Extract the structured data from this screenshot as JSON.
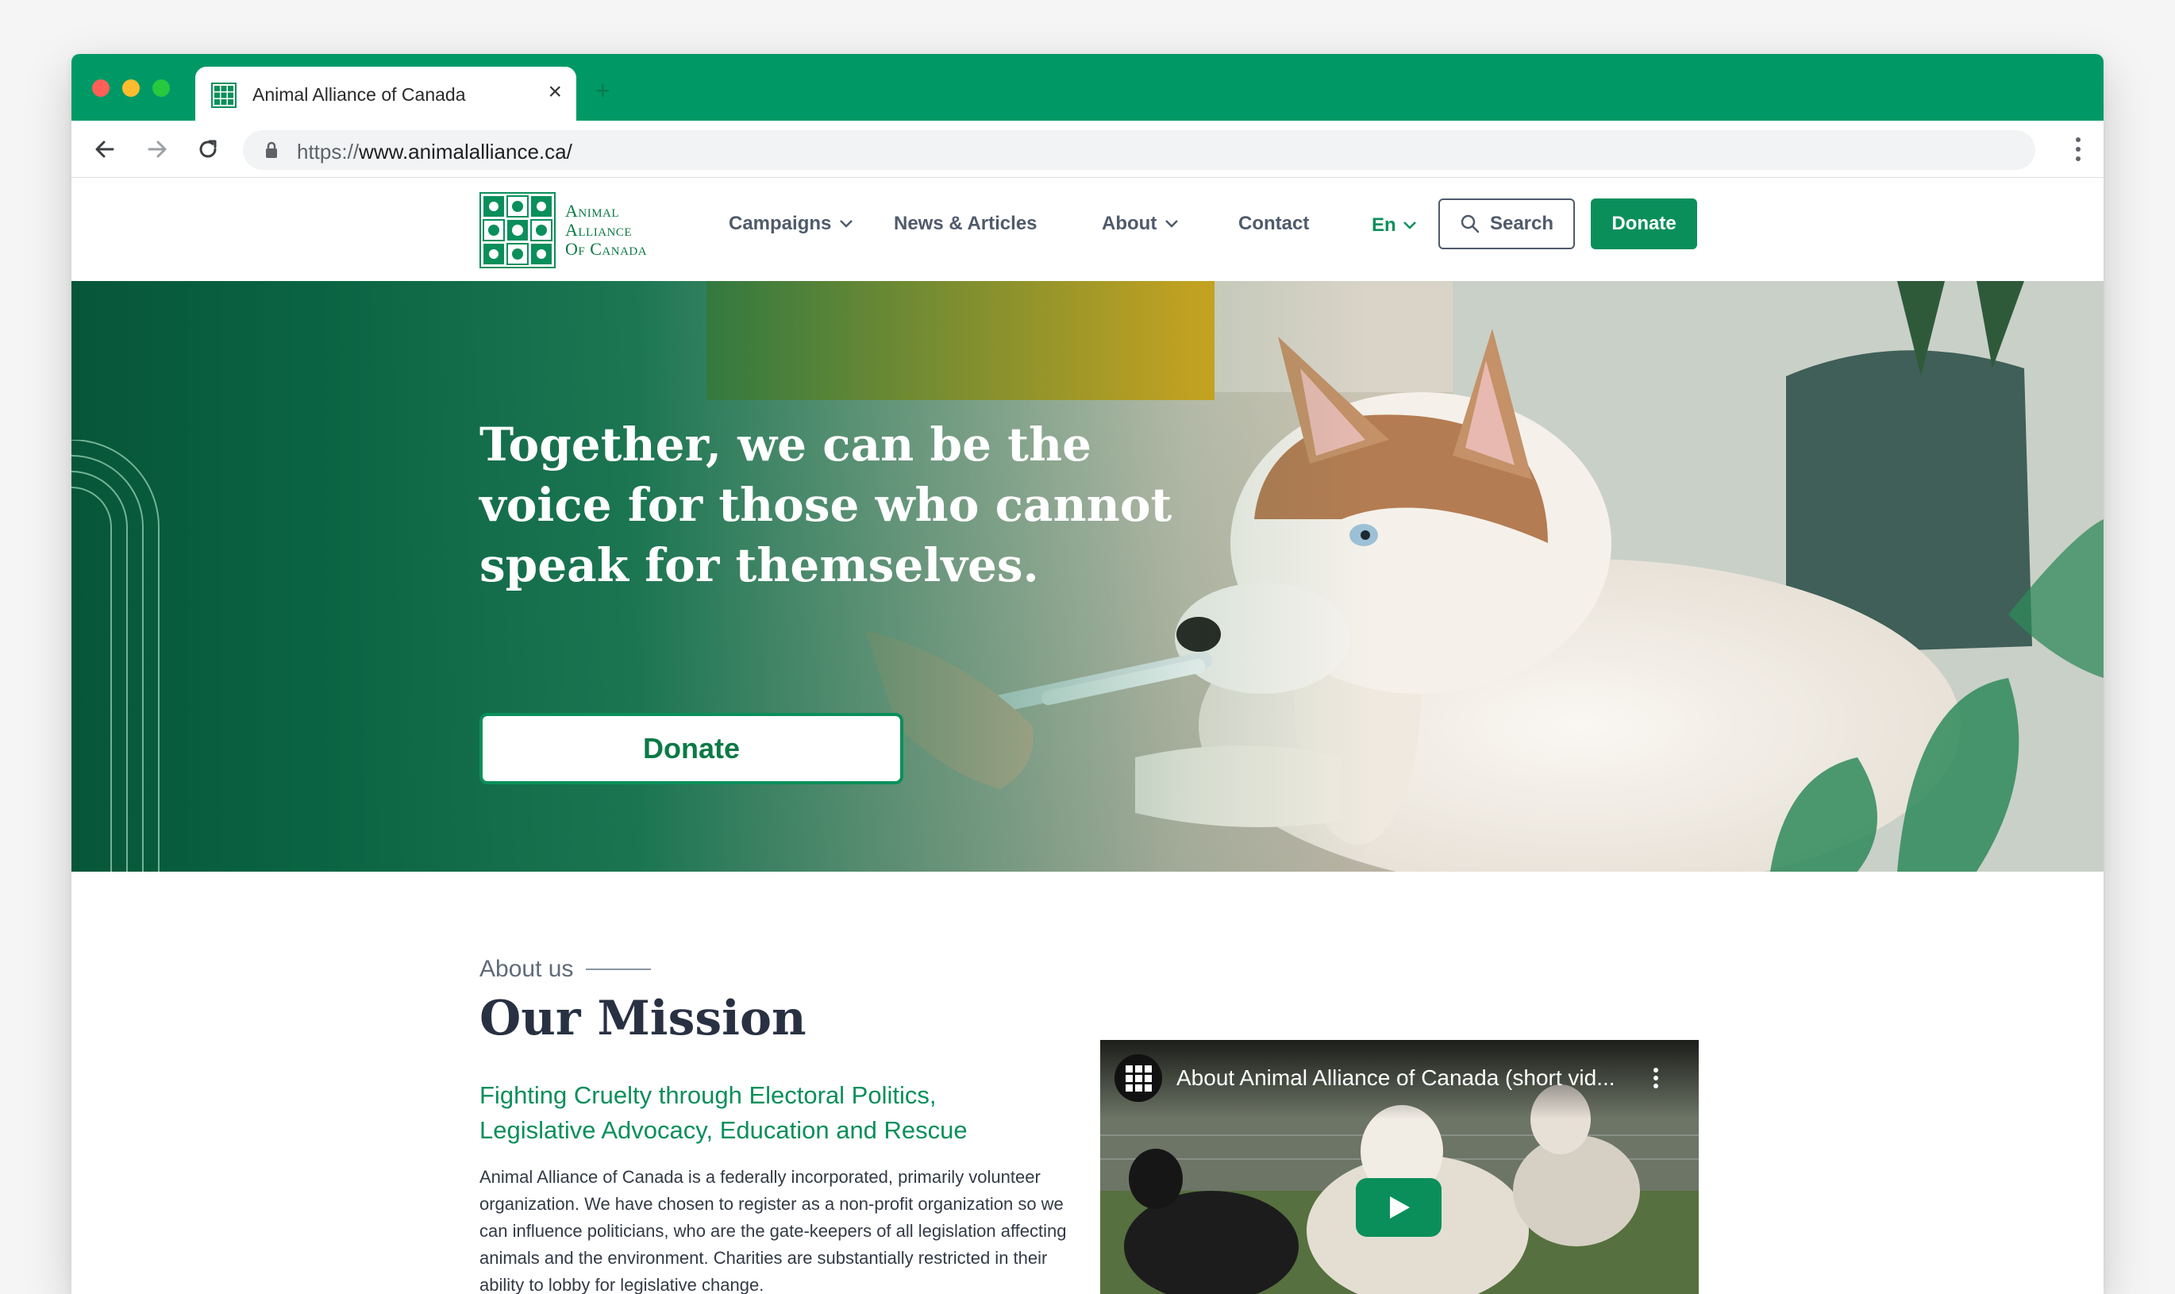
{
  "browser": {
    "tab_title": "Animal Alliance of Canada",
    "tab_close": "×",
    "new_tab": "+",
    "url_scheme": "https://",
    "url_rest": "www.animalalliance.ca/"
  },
  "colors": {
    "brand_green": "#0a8f5b",
    "tabbar_green": "#009966",
    "heading_dark": "#283142"
  },
  "logo": {
    "line1": "Animal",
    "line2": "Alliance",
    "line3": "Of Canada"
  },
  "nav": {
    "campaigns": "Campaigns",
    "news": "News & Articles",
    "about": "About",
    "contact": "Contact",
    "lang": "En",
    "search": "Search",
    "donate": "Donate"
  },
  "hero": {
    "title": "Together, we can be the voice for those who cannot speak for themselves.",
    "donate": "Donate"
  },
  "mission": {
    "eyebrow": "About us",
    "title": "Our Mission",
    "subtitle": "Fighting Cruelty through Electoral Politics, Legislative Advocacy, Education and Rescue",
    "body": "Animal Alliance of Canada is a federally incorporated, primarily volunteer organization. We have chosen to register as a non-profit organization so we can influence politicians, who are the gate-keepers of all legislation affecting animals and the environment. Charities are substantially restricted in their ability to lobby for legislative change."
  },
  "video": {
    "title": "About Animal Alliance of Canada (short vid..."
  },
  "icons": [
    "favicon-icon",
    "back-icon",
    "forward-icon",
    "reload-icon",
    "lock-icon",
    "kebab-menu-icon",
    "chevron-down-icon",
    "search-icon",
    "play-icon"
  ]
}
